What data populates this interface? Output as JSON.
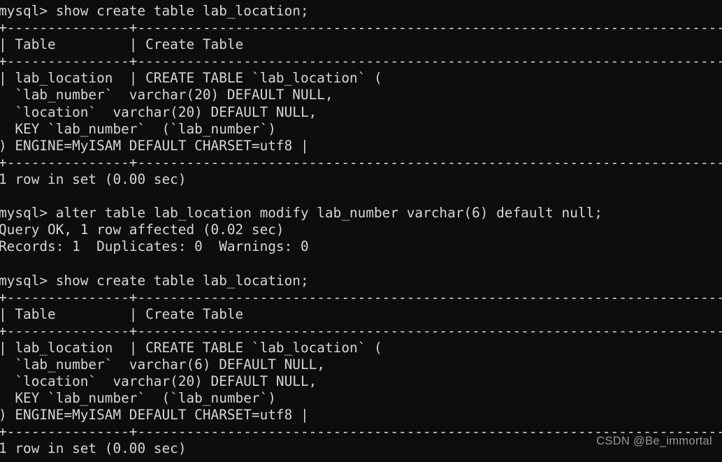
{
  "terminal": {
    "title": "mysql> show create table lab_location;",
    "background_color": "#0d0d0d",
    "text_color": "#d6d6d6",
    "prompt": "mysql>",
    "lines": [
      "mysql> show create table lab_location;",
      "+---------------+-----------------------------------------------------------------------------------------------",
      "| Table         | Create Table",
      "+---------------+-----------------------------------------------------------------------------------------------",
      "| lab_location  | CREATE TABLE `lab_location` (",
      "  `lab_number`  varchar(20) DEFAULT NULL,",
      "  `location`  varchar(20) DEFAULT NULL,",
      "  KEY `lab_number`  (`lab_number`)",
      ") ENGINE=MyISAM DEFAULT CHARSET=utf8 |",
      "+---------------+-----------------------------------------------------------------------------------------------",
      "1 row in set (0.00 sec)",
      "",
      "mysql> alter table lab_location modify lab_number varchar(6) default null;",
      "Query OK, 1 row affected (0.02 sec)",
      "Records: 1  Duplicates: 0  Warnings: 0",
      "",
      "mysql> show create table lab_location;",
      "+---------------+-----------------------------------------------------------------------------------------------",
      "| Table         | Create Table",
      "+---------------+-----------------------------------------------------------------------------------------------",
      "| lab_location  | CREATE TABLE `lab_location` (",
      "  `lab_number`  varchar(6) DEFAULT NULL,",
      "  `location`  varchar(20) DEFAULT NULL,",
      "  KEY `lab_number`  (`lab_number`)",
      ") ENGINE=MyISAM DEFAULT CHARSET=utf8 |",
      "+---------------+-----------------------------------------------------------------------------------------------",
      "1 row in set (0.00 sec)"
    ]
  },
  "watermark": {
    "text": "CSDN @Be_immortal"
  }
}
